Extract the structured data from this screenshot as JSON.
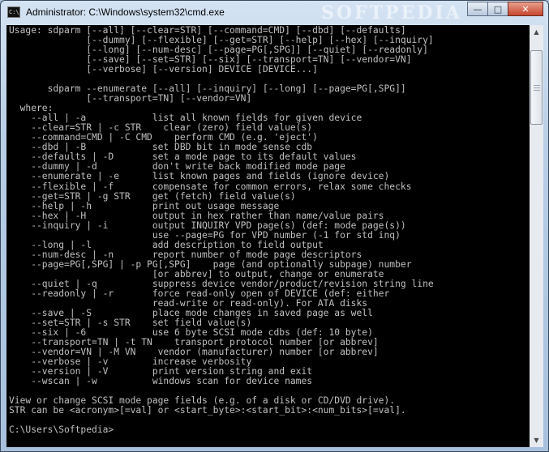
{
  "window": {
    "title": "Administrator: C:\\Windows\\system32\\cmd.exe",
    "app_icon_text": "C:\\_",
    "watermark": "SOFTPEDIA",
    "buttons": {
      "minimize": "—",
      "maximize": "□",
      "close": "✕"
    }
  },
  "console": {
    "lines": [
      "Usage: sdparm [--all] [--clear=STR] [--command=CMD] [--dbd] [--defaults]",
      "              [--dummy] [--flexible] [--get=STR] [--help] [--hex] [--inquiry]",
      "              [--long] [--num-desc] [--page=PG[,SPG]] [--quiet] [--readonly]",
      "              [--save] [--set=STR] [--six] [--transport=TN] [--vendor=VN]",
      "              [--verbose] [--version] DEVICE [DEVICE...]",
      "",
      "       sdparm --enumerate [--all] [--inquiry] [--long] [--page=PG[,SPG]]",
      "              [--transport=TN] [--vendor=VN]",
      "  where:",
      "    --all | -a            list all known fields for given device",
      "    --clear=STR | -c STR    clear (zero) field value(s)",
      "    --command=CMD | -C CMD    perform CMD (e.g. 'eject')",
      "    --dbd | -B            set DBD bit in mode sense cdb",
      "    --defaults | -D       set a mode page to its default values",
      "    --dummy | -d          don't write back modified mode page",
      "    --enumerate | -e      list known pages and fields (ignore device)",
      "    --flexible | -f       compensate for common errors, relax some checks",
      "    --get=STR | -g STR    get (fetch) field value(s)",
      "    --help | -h           print out usage message",
      "    --hex | -H            output in hex rather than name/value pairs",
      "    --inquiry | -i        output INQUIRY VPD page(s) (def: mode page(s))",
      "                          use --page=PG for VPD number (-1 for std inq)",
      "    --long | -l           add description to field output",
      "    --num-desc | -n       report number of mode page descriptors",
      "    --page=PG[,SPG] | -p PG[,SPG]    page (and optionally subpage) number",
      "                          [or abbrev] to output, change or enumerate",
      "    --quiet | -q          suppress device vendor/product/revision string line",
      "    --readonly | -r       force read-only open of DEVICE (def: either",
      "                          read-write or read-only). For ATA disks",
      "    --save | -S           place mode changes in saved page as well",
      "    --set=STR | -s STR    set field value(s)",
      "    --six | -6            use 6 byte SCSI mode cdbs (def: 10 byte)",
      "    --transport=TN | -t TN    transport protocol number [or abbrev]",
      "    --vendor=VN | -M VN    vendor (manufacturer) number [or abbrev]",
      "    --verbose | -v        increase verbosity",
      "    --version | -V        print version string and exit",
      "    --wscan | -w          windows scan for device names",
      "",
      "View or change SCSI mode page fields (e.g. of a disk or CD/DVD drive).",
      "STR can be <acronym>[=val] or <start_byte>:<start_bit>:<num_bits>[=val].",
      "",
      "C:\\Users\\Softpedia>"
    ]
  },
  "scrollbar": {
    "up_arrow": "▲",
    "down_arrow": "▼"
  }
}
